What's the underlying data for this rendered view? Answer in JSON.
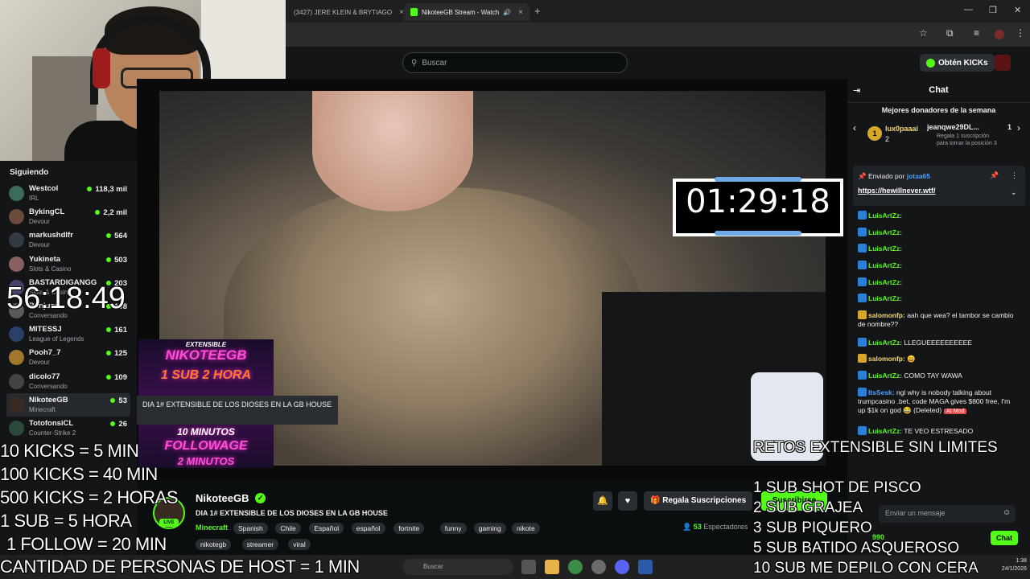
{
  "browser": {
    "tabs": [
      {
        "title": "(3427) JERE KLEIN & BRYTIAGO",
        "close": "×"
      },
      {
        "title": "NikoteeGB Stream - Watch",
        "close": "×"
      }
    ],
    "new_tab": "+",
    "window_controls": [
      "—",
      "❐",
      "✕"
    ]
  },
  "header": {
    "search_placeholder": "Buscar",
    "kicks_button": "Obtén KICKs"
  },
  "sidebar": {
    "title": "Siguiendo",
    "items": [
      {
        "name": "Westcol",
        "category": "IRL",
        "viewers": "118,3 mil",
        "color": "#3b6b5a"
      },
      {
        "name": "BykingCL",
        "category": "Devour",
        "viewers": "2,2 mil",
        "color": "#6b4a3b"
      },
      {
        "name": "markushdlfr",
        "category": "Devour",
        "viewers": "564",
        "color": "#333a44"
      },
      {
        "name": "Yukineta",
        "category": "Slots & Casino",
        "viewers": "503",
        "color": "#8a5f5f"
      },
      {
        "name": "BASTARDIGANGG",
        "category": "Slots & Casino",
        "viewers": "203",
        "color": "#4b3f6b"
      },
      {
        "name": "Benjucu",
        "category": "Conversando",
        "viewers": "198",
        "color": "#5a5a5a"
      },
      {
        "name": "MITESSJ",
        "category": "League of Legends",
        "viewers": "161",
        "color": "#2b3f6b"
      },
      {
        "name": "Pooh7_7",
        "category": "Devour",
        "viewers": "125",
        "color": "#a0782b"
      },
      {
        "name": "dicolo77",
        "category": "Conversando",
        "viewers": "109",
        "color": "#444"
      },
      {
        "name": "NikoteeGB",
        "category": "Minecraft",
        "viewers": "53",
        "color": "#3a2b22"
      },
      {
        "name": "TotofonsiCL",
        "category": "Counter-Strike 2",
        "viewers": "26",
        "color": "#2b4a3b"
      }
    ]
  },
  "video": {
    "timer": "01:29:18",
    "promo_lines": [
      "EXTENSIBLE",
      "NIKOTEEGB",
      "1 SUB 2 HORA",
      "10 MINUTOS",
      "FOLLOWAGE",
      "2 MINUTOS"
    ],
    "tooltip": "DIA 1# EXTENSIBLE DE LOS DIOSES EN LA GB HOUSE"
  },
  "stream": {
    "live_badge": "LIVE",
    "verified": "✓",
    "streamer": "NikoteeGB",
    "title": "DIA 1# EXTENSIBLE DE LOS DIOSES EN LA GB HOUSE",
    "category": "Minecraft",
    "tags_row1": [
      "Spanish",
      "Chile",
      "Español",
      "español",
      "fortnite",
      "funny",
      "gaming",
      "nikote"
    ],
    "tags_row2": [
      "nikotegb",
      "streamer",
      "viral"
    ],
    "gift_button": "Regala Suscripciones",
    "subscribe_button": "Suscribirse",
    "viewers_count": "53",
    "viewers_label": "Espectadores"
  },
  "chat": {
    "title": "Chat",
    "donors_title": "Mejores donadores de la semana",
    "donor1": {
      "name": "lux0paaai",
      "rank": "1",
      "count": "2"
    },
    "donor2": {
      "name": "jeanqwe29DL...",
      "rank": "1",
      "sub1": "Regala 1 suscripción",
      "sub2": "para tomar la posición 3"
    },
    "pinned_by_label": "Enviado por",
    "pinned_by": "jotaa65",
    "pinned_link": "https://hewillnever.wtf/",
    "messages": [
      {
        "user": "LuisArtZz:",
        "text": "",
        "color": "#53fc18"
      },
      {
        "user": "LuisArtZz:",
        "text": "",
        "color": "#53fc18"
      },
      {
        "user": "LuisArtZz:",
        "text": "",
        "color": "#53fc18"
      },
      {
        "user": "LuisArtZz:",
        "text": "",
        "color": "#53fc18"
      },
      {
        "user": "LuisArtZz:",
        "text": "",
        "color": "#53fc18"
      },
      {
        "user": "LuisArtZz:",
        "text": "",
        "color": "#53fc18"
      },
      {
        "user": "salomonfp:",
        "text": "aah que wea? el tambor se cambio de nombre??",
        "color": "#f5d76e"
      },
      {
        "user": "LuisArtZz:",
        "text": "LLEGUEEEEEEEEEE",
        "color": "#53fc18"
      },
      {
        "user": "salomonfp:",
        "text": "😄",
        "color": "#f5d76e"
      },
      {
        "user": "LuisArtZz:",
        "text": "COMO TAY WAWA",
        "color": "#53fc18"
      },
      {
        "user": "ItsSesk:",
        "text": "ngl why is nobody talking about trumpcasino .bet, code MAGA gives $800 free, I'm up $1k on god 😂 (Deleted)",
        "color": "#4aa3ff"
      },
      {
        "user": "LuisArtZz:",
        "text": "TE VEO ESTRESADO",
        "color": "#53fc18"
      }
    ],
    "ai_mod": "AI Mod",
    "input_placeholder": "Enviar un mensaje",
    "send_button": "Chat",
    "points": "990"
  },
  "taskbar": {
    "search": "Buscar",
    "time": "1:38",
    "date": "24/1/2026"
  },
  "overlays": {
    "big_timer": "56:18:49",
    "left_lines": [
      "10 KICKS = 5 MIN",
      "100 KICKS = 40 MIN",
      "500 KICKS = 2 HORAS",
      "1 SUB = 5 HORA",
      "1 FOLLOW = 20 MIN",
      "CANTIDAD DE PERSONAS DE HOST = 1 MIN"
    ],
    "right_title": "RETOS EXTENSIBLE SIN LIMITES",
    "right_lines": [
      "1 SUB SHOT DE PISCO",
      "2 SUB GRAJEA",
      "3 SUB PIQUERO",
      "5 SUB BATIDO ASQUEROSO",
      "10 SUB ME DEPILO CON CERA"
    ]
  },
  "colors": {
    "accent": "#53fc18",
    "background": "#0b0e0f",
    "panel": "#141517"
  }
}
